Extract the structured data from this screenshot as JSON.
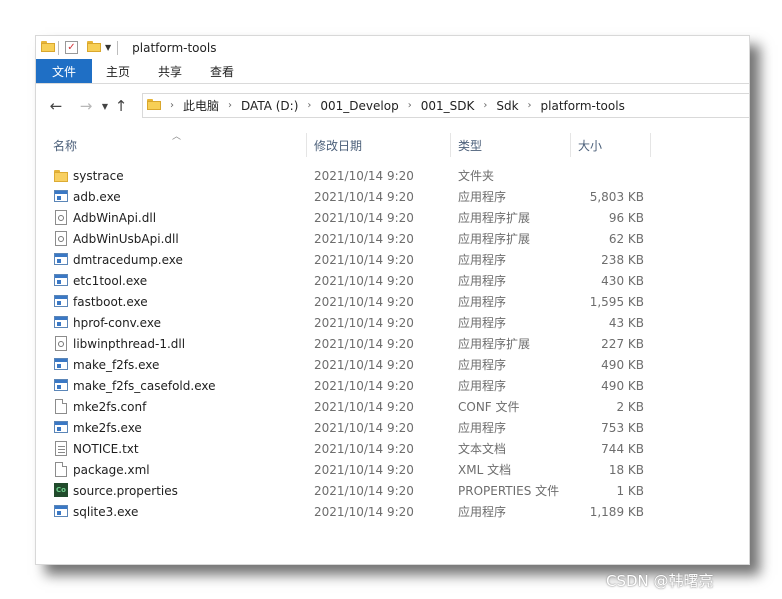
{
  "window": {
    "title": "platform-tools"
  },
  "ribbon": {
    "tabs": [
      "文件",
      "主页",
      "共享",
      "查看"
    ]
  },
  "address": {
    "crumbs": [
      "此电脑",
      "DATA (D:)",
      "001_Develop",
      "001_SDK",
      "Sdk",
      "platform-tools"
    ]
  },
  "columns": {
    "name": "名称",
    "date": "修改日期",
    "type": "类型",
    "size": "大小"
  },
  "files": [
    {
      "name": "systrace",
      "date": "2021/10/14 9:20",
      "type": "文件夹",
      "size": "",
      "icon": "folder"
    },
    {
      "name": "adb.exe",
      "date": "2021/10/14 9:20",
      "type": "应用程序",
      "size": "5,803 KB",
      "icon": "exe"
    },
    {
      "name": "AdbWinApi.dll",
      "date": "2021/10/14 9:20",
      "type": "应用程序扩展",
      "size": "96 KB",
      "icon": "dll"
    },
    {
      "name": "AdbWinUsbApi.dll",
      "date": "2021/10/14 9:20",
      "type": "应用程序扩展",
      "size": "62 KB",
      "icon": "dll"
    },
    {
      "name": "dmtracedump.exe",
      "date": "2021/10/14 9:20",
      "type": "应用程序",
      "size": "238 KB",
      "icon": "exe"
    },
    {
      "name": "etc1tool.exe",
      "date": "2021/10/14 9:20",
      "type": "应用程序",
      "size": "430 KB",
      "icon": "exe"
    },
    {
      "name": "fastboot.exe",
      "date": "2021/10/14 9:20",
      "type": "应用程序",
      "size": "1,595 KB",
      "icon": "exe"
    },
    {
      "name": "hprof-conv.exe",
      "date": "2021/10/14 9:20",
      "type": "应用程序",
      "size": "43 KB",
      "icon": "exe"
    },
    {
      "name": "libwinpthread-1.dll",
      "date": "2021/10/14 9:20",
      "type": "应用程序扩展",
      "size": "227 KB",
      "icon": "dll"
    },
    {
      "name": "make_f2fs.exe",
      "date": "2021/10/14 9:20",
      "type": "应用程序",
      "size": "490 KB",
      "icon": "exe"
    },
    {
      "name": "make_f2fs_casefold.exe",
      "date": "2021/10/14 9:20",
      "type": "应用程序",
      "size": "490 KB",
      "icon": "exe"
    },
    {
      "name": "mke2fs.conf",
      "date": "2021/10/14 9:20",
      "type": "CONF 文件",
      "size": "2 KB",
      "icon": "doc"
    },
    {
      "name": "mke2fs.exe",
      "date": "2021/10/14 9:20",
      "type": "应用程序",
      "size": "753 KB",
      "icon": "exe"
    },
    {
      "name": "NOTICE.txt",
      "date": "2021/10/14 9:20",
      "type": "文本文档",
      "size": "744 KB",
      "icon": "txt"
    },
    {
      "name": "package.xml",
      "date": "2021/10/14 9:20",
      "type": "XML 文档",
      "size": "18 KB",
      "icon": "doc"
    },
    {
      "name": "source.properties",
      "date": "2021/10/14 9:20",
      "type": "PROPERTIES 文件",
      "size": "1 KB",
      "icon": "co",
      "icon_text": "Co"
    },
    {
      "name": "sqlite3.exe",
      "date": "2021/10/14 9:20",
      "type": "应用程序",
      "size": "1,189 KB",
      "icon": "exe"
    }
  ],
  "watermark": "CSDN @韩曙亮",
  "colors": {
    "file_tab": "#1f6fc5",
    "folder": "#f8d062",
    "header_text": "#4c607a"
  }
}
